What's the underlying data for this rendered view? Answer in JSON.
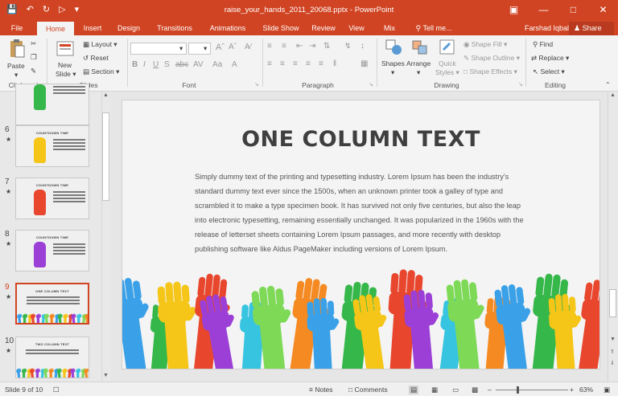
{
  "titlebar": {
    "title": "raise_your_hands_2011_20068.pptx - PowerPoint",
    "qat_icons": [
      "save-icon",
      "undo-icon",
      "redo-icon",
      "customize-icon"
    ],
    "win_icons": [
      "ribbon-display-icon",
      "minimize-icon",
      "maximize-icon",
      "close-icon"
    ]
  },
  "tabs": [
    "File",
    "Home",
    "Insert",
    "Design",
    "Transitions",
    "Animations",
    "Slide Show",
    "Review",
    "View",
    "Mix",
    "Tell me..."
  ],
  "account": {
    "user": "Farshad Iqbal",
    "share": "Share"
  },
  "ribbon": {
    "clipboard": {
      "label": "Clipboard",
      "paste": "Paste"
    },
    "slides": {
      "label": "Slides",
      "new_slide": "New",
      "new_slide2": "Slide",
      "layout": "Layout",
      "reset": "Reset",
      "section": "Section"
    },
    "font": {
      "label": "Font"
    },
    "paragraph": {
      "label": "Paragraph"
    },
    "drawing": {
      "label": "Drawing",
      "shapes": "Shapes",
      "arrange": "Arrange",
      "quick": "Quick",
      "styles": "Styles",
      "fill": "Shape Fill",
      "outline": "Shape Outline",
      "effects": "Shape Effects"
    },
    "editing": {
      "label": "Editing",
      "find": "Find",
      "replace": "Replace",
      "select": "Select"
    }
  },
  "thumbnails": [
    {
      "num": "",
      "title": "",
      "hand_color": "#35b74a"
    },
    {
      "num": "6",
      "title": "COUNTDOWN TIME",
      "hand_color": "#f5c518"
    },
    {
      "num": "7",
      "title": "COUNTDOWN TIME",
      "hand_color": "#e8472e"
    },
    {
      "num": "8",
      "title": "COUNTDOWN TIME",
      "hand_color": "#9b3fd6"
    },
    {
      "num": "9",
      "title": "ONE COLUMN TEXT",
      "hand_color": ""
    },
    {
      "num": "10",
      "title": "TWO COLUMN TEXT",
      "hand_color": ""
    }
  ],
  "slide": {
    "title": "ONE COLUMN TEXT",
    "body": "Simply dummy text of the printing and typesetting industry. Lorem Ipsum has been the industry's standard dummy text ever since the 1500s, when an unknown printer took a galley of type and scrambled it to make a type specimen book. It has survived not only five centuries, but also the leap into electronic typesetting, remaining essentially unchanged. It was popularized in the 1960s with the release of letterset sheets containing Lorem Ipsum passages, and more recently with desktop publishing software like Aldus PageMaker including versions of Lorem Ipsum."
  },
  "status": {
    "slide": "Slide 9 of 10",
    "notes": "Notes",
    "comments": "Comments",
    "zoom": "63%"
  },
  "colors": {
    "accent": "#d04423",
    "hands": [
      "#3aa0e8",
      "#35b74a",
      "#f5c518",
      "#e8472e",
      "#9b3fd6",
      "#37c4e0",
      "#7ed957",
      "#f58a23"
    ]
  }
}
